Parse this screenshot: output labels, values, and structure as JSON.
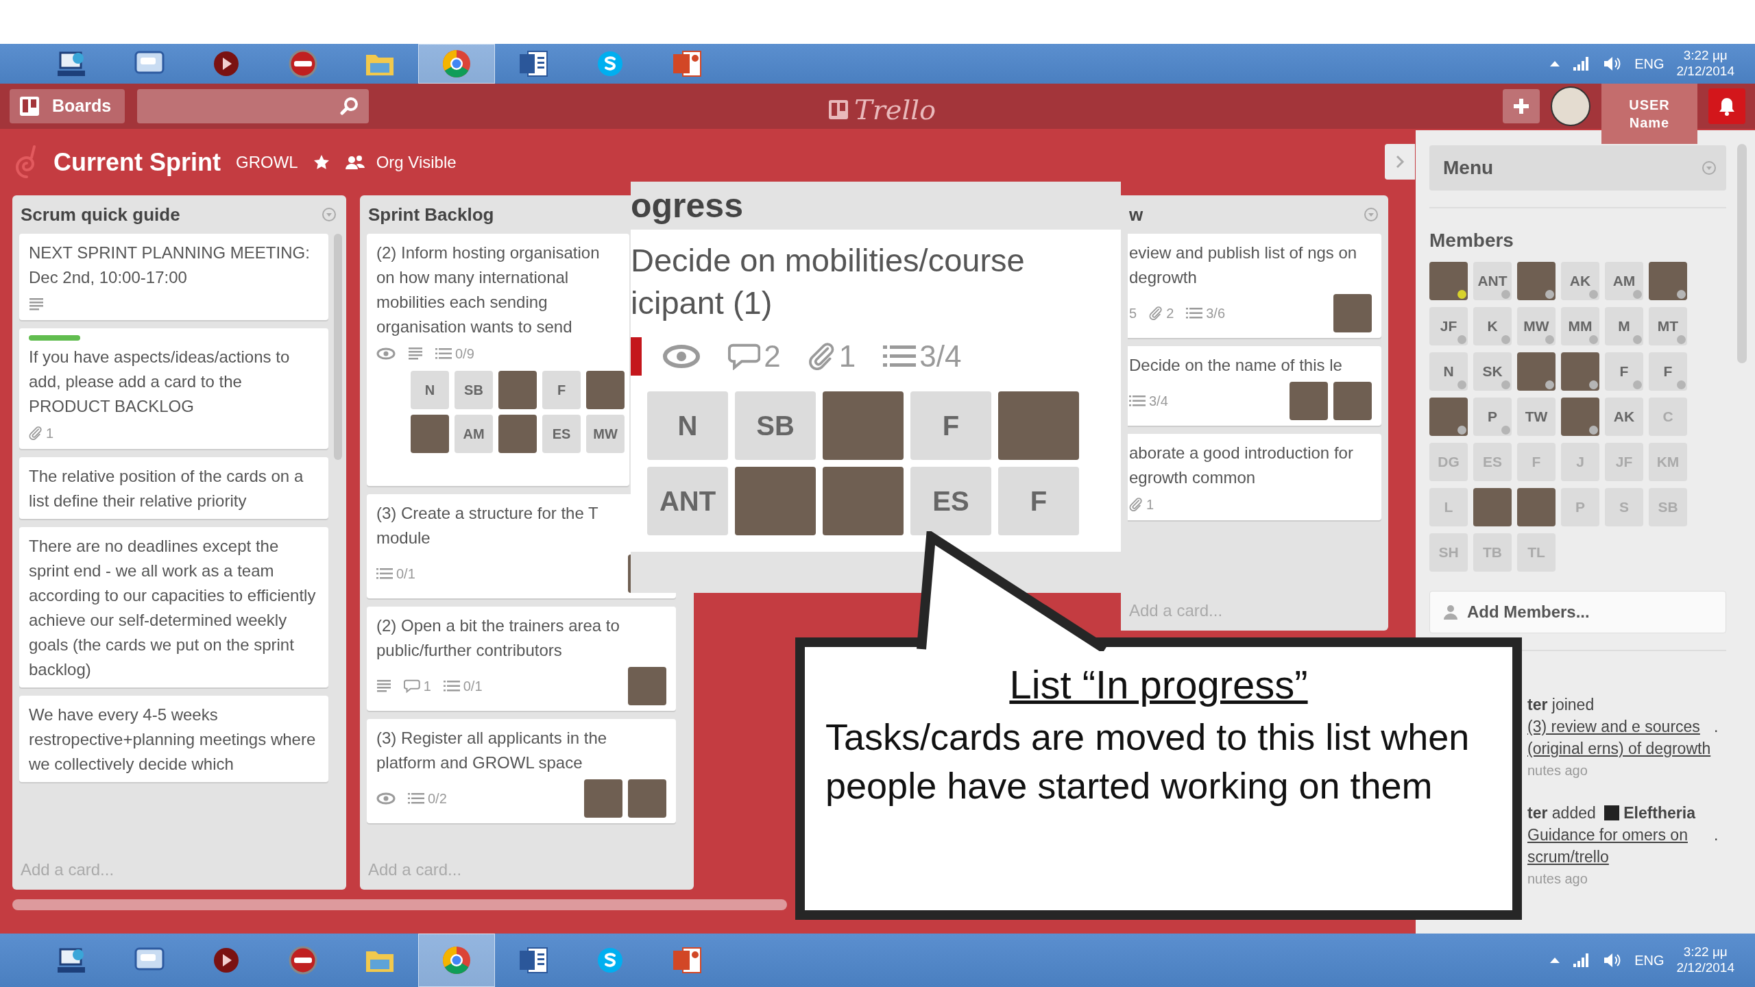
{
  "taskbar_top": {
    "apps": [
      {
        "selected": false
      },
      {
        "selected": false
      },
      {
        "selected": false
      },
      {
        "selected": false
      },
      {
        "selected": false
      },
      {
        "selected": true
      },
      {
        "selected": false
      },
      {
        "selected": false
      },
      {
        "selected": false
      }
    ],
    "language": "ENG",
    "time": "3:22 μμ",
    "date": "2/12/2014"
  },
  "header": {
    "boards_button": "Boards",
    "logo": "Trello",
    "user_label": "USER Name"
  },
  "board": {
    "title": "Current Sprint",
    "organization": "GROWL",
    "visibility": "Org Visible"
  },
  "lists": [
    {
      "kind": "full",
      "title": "Scrum quick guide",
      "menu_icon": true,
      "cards": [
        {
          "text": "NEXT SPRINT PLANNING MEETING: Dec 2nd, 10:00-17:00",
          "badges": [
            {
              "kind": "description"
            }
          ]
        },
        {
          "labels": [
            {
              "color": "#61bd4f"
            }
          ],
          "text": "If you have aspects/ideas/actions to add, please add a card to the PRODUCT BACKLOG",
          "badges": [
            {
              "kind": "attachments",
              "text": "1"
            }
          ]
        },
        {
          "text": "The relative position of the cards on a list define their relative priority"
        },
        {
          "text": "There are no deadlines except the sprint end - we all work as a team according to our capacities to efficiently achieve our self-determined weekly goals (the cards we put on the sprint backlog)"
        },
        {
          "text": "We have every 4-5 weeks restropective+planning meetings where we collectively decide which"
        }
      ],
      "add_card": "Add a card..."
    },
    {
      "kind": "full",
      "title": "Sprint Backlog",
      "menu_icon": false,
      "cards": [
        {
          "text": "(2) Inform hosting organisation on how many international mobilities each sending organisation wants to send",
          "badges": [
            {
              "kind": "watch"
            },
            {
              "kind": "description"
            },
            {
              "kind": "checklist",
              "text": "0/9",
              "complete": false
            }
          ],
          "members": [
            {
              "kind": "initials",
              "initials": "N"
            },
            {
              "kind": "initials",
              "initials": "SB"
            },
            {
              "kind": "photo"
            },
            {
              "kind": "initials",
              "initials": "F"
            },
            {
              "kind": "photo"
            },
            {
              "kind": "photo"
            },
            {
              "kind": "initials",
              "initials": "AM"
            },
            {
              "kind": "photo"
            },
            {
              "kind": "initials",
              "initials": "ES"
            },
            {
              "kind": "initials",
              "initials": "MW"
            }
          ]
        },
        {
          "text": "(3) Create a structure for the T module",
          "badges": [
            {
              "kind": "checklist",
              "text": "0/1",
              "complete": false
            }
          ],
          "members": [
            {
              "kind": "photo"
            }
          ]
        },
        {
          "text": "(2) Open a bit the trainers area to public/further contributors",
          "badges": [
            {
              "kind": "description"
            },
            {
              "kind": "comments",
              "text": "1"
            },
            {
              "kind": "checklist",
              "text": "0/1",
              "complete": false
            }
          ],
          "members": [
            {
              "kind": "photo"
            }
          ]
        },
        {
          "text": "(3) Register all applicants in the platform and GROWL space",
          "badges": [
            {
              "kind": "watch"
            },
            {
              "kind": "checklist",
              "text": "0/2",
              "complete": false
            }
          ],
          "members": [
            {
              "kind": "photo"
            },
            {
              "kind": "photo"
            }
          ]
        }
      ],
      "add_card": "Add a card..."
    },
    {
      "kind": "clipped",
      "title": "w",
      "menu_icon": true,
      "cards": [
        {
          "text": "eview and publish list of ngs on degrowth",
          "badges": [
            {
              "kind": "plain",
              "text": "5"
            },
            {
              "kind": "attachments",
              "text": "2"
            },
            {
              "kind": "checklist",
              "text": "3/6",
              "complete": false
            }
          ],
          "members": [
            {
              "kind": "photo"
            }
          ]
        },
        {
          "text": "Decide on the name of this le",
          "badges": [
            {
              "kind": "checklist",
              "text": "3/4",
              "complete": false
            }
          ],
          "members": [
            {
              "kind": "photo"
            },
            {
              "kind": "photo"
            }
          ]
        },
        {
          "text": "aborate a good introduction for egrowth common",
          "badges": [
            {
              "kind": "attachments",
              "text": "1"
            }
          ]
        }
      ],
      "add_card": "Add a card..."
    }
  ],
  "zoom_inset": {
    "list_title": "ogress",
    "card": {
      "labels": [
        {
          "color": "#c4161c"
        }
      ],
      "text": "Decide on mobilities/course icipant (1)",
      "badges": [
        {
          "kind": "watch"
        },
        {
          "kind": "comments",
          "text": "2"
        },
        {
          "kind": "attachments",
          "text": "1"
        },
        {
          "kind": "checklist",
          "text": "3/4",
          "complete": false
        }
      ],
      "members": [
        {
          "kind": "initials",
          "initials": "N"
        },
        {
          "kind": "initials",
          "initials": "SB"
        },
        {
          "kind": "photo"
        },
        {
          "kind": "initials",
          "initials": "F"
        },
        {
          "kind": "photo"
        },
        {
          "kind": "initials",
          "initials": "ANT"
        },
        {
          "kind": "photo"
        },
        {
          "kind": "photo"
        },
        {
          "kind": "initials",
          "initials": "ES"
        },
        {
          "kind": "initials",
          "initials": "F"
        }
      ]
    }
  },
  "menu": {
    "title": "Menu",
    "members_heading": "Members",
    "members": [
      {
        "kind": "photo",
        "color": "#d8d22c"
      },
      {
        "kind": "initials",
        "initials": "ANT",
        "color": "#b5b5b5",
        "disabled": false
      },
      {
        "kind": "photo",
        "color": "#b5b5b5"
      },
      {
        "kind": "initials",
        "initials": "AK",
        "color": "#b5b5b5",
        "disabled": false
      },
      {
        "kind": "initials",
        "initials": "AM",
        "color": "#b5b5b5",
        "disabled": false
      },
      {
        "kind": "photo",
        "color": "#b5b5b5"
      },
      {
        "kind": "initials",
        "initials": "JF",
        "color": "#b5b5b5",
        "disabled": false
      },
      {
        "kind": "initials",
        "initials": "K",
        "color": "#b5b5b5",
        "disabled": false
      },
      {
        "kind": "initials",
        "initials": "MW",
        "color": "#b5b5b5",
        "disabled": false
      },
      {
        "kind": "initials",
        "initials": "MM",
        "color": "#b5b5b5",
        "disabled": false
      },
      {
        "kind": "initials",
        "initials": "M",
        "color": "#b5b5b5",
        "disabled": false
      },
      {
        "kind": "initials",
        "initials": "MT",
        "color": "#b5b5b5",
        "disabled": false
      },
      {
        "kind": "initials",
        "initials": "N",
        "color": "#b5b5b5",
        "disabled": false
      },
      {
        "kind": "initials",
        "initials": "SK",
        "color": "#b5b5b5",
        "disabled": false
      },
      {
        "kind": "photo",
        "color": "#b5b5b5"
      },
      {
        "kind": "photo",
        "color": "#b5b5b5"
      },
      {
        "kind": "initials",
        "initials": "F",
        "color": "#b5b5b5",
        "disabled": false
      },
      {
        "kind": "initials",
        "initials": "F",
        "color": "#b5b5b5",
        "disabled": false
      },
      {
        "kind": "photo",
        "color": "#b5b5b5"
      },
      {
        "kind": "initials",
        "initials": "P",
        "color": "#b5b5b5",
        "disabled": false
      },
      {
        "kind": "initials",
        "initials": "TW",
        "disabled": false
      },
      {
        "kind": "photo",
        "color": "#b5b5b5"
      },
      {
        "kind": "initials",
        "initials": "AK",
        "disabled": false
      },
      {
        "kind": "initials",
        "initials": "C",
        "disabled": true
      },
      {
        "kind": "initials",
        "initials": "DG",
        "disabled": true
      },
      {
        "kind": "initials",
        "initials": "ES",
        "disabled": true
      },
      {
        "kind": "initials",
        "initials": "F",
        "disabled": true
      },
      {
        "kind": "initials",
        "initials": "J",
        "disabled": true
      },
      {
        "kind": "initials",
        "initials": "JF",
        "disabled": true
      },
      {
        "kind": "initials",
        "initials": "KM",
        "disabled": true
      },
      {
        "kind": "initials",
        "initials": "L",
        "disabled": true
      },
      {
        "kind": "photo"
      },
      {
        "kind": "photo"
      },
      {
        "kind": "initials",
        "initials": "P",
        "disabled": true
      },
      {
        "kind": "initials",
        "initials": "S",
        "disabled": true
      },
      {
        "kind": "initials",
        "initials": "SB",
        "disabled": true
      },
      {
        "kind": "initials",
        "initials": "SH",
        "disabled": true
      },
      {
        "kind": "initials",
        "initials": "TB",
        "disabled": true
      },
      {
        "kind": "initials",
        "initials": "TL",
        "disabled": true
      }
    ],
    "add_members_button": "Add Members...",
    "activity": [
      {
        "text": "**ter** joined",
        "link": "(3) review and e sources (original erns) of degrowth",
        "tail": ".",
        "time": "nutes ago"
      },
      {
        "text": "**ter** added",
        "member": "Eleftheria",
        "link": "Guidance for omers on scrum/trello",
        "tail": ".",
        "time": "nutes ago"
      }
    ]
  },
  "callout": {
    "title": "List “In progress”",
    "body": "Tasks/cards are moved to this list when people have started working on them"
  },
  "taskbar_bottom": {
    "apps": [
      {
        "selected": false
      },
      {
        "selected": false
      },
      {
        "selected": false
      },
      {
        "selected": false
      },
      {
        "selected": false
      },
      {
        "selected": true
      },
      {
        "selected": false
      },
      {
        "selected": false
      },
      {
        "selected": false
      }
    ],
    "language": "ENG",
    "time": "3:22 μμ",
    "date": "2/12/2014"
  }
}
